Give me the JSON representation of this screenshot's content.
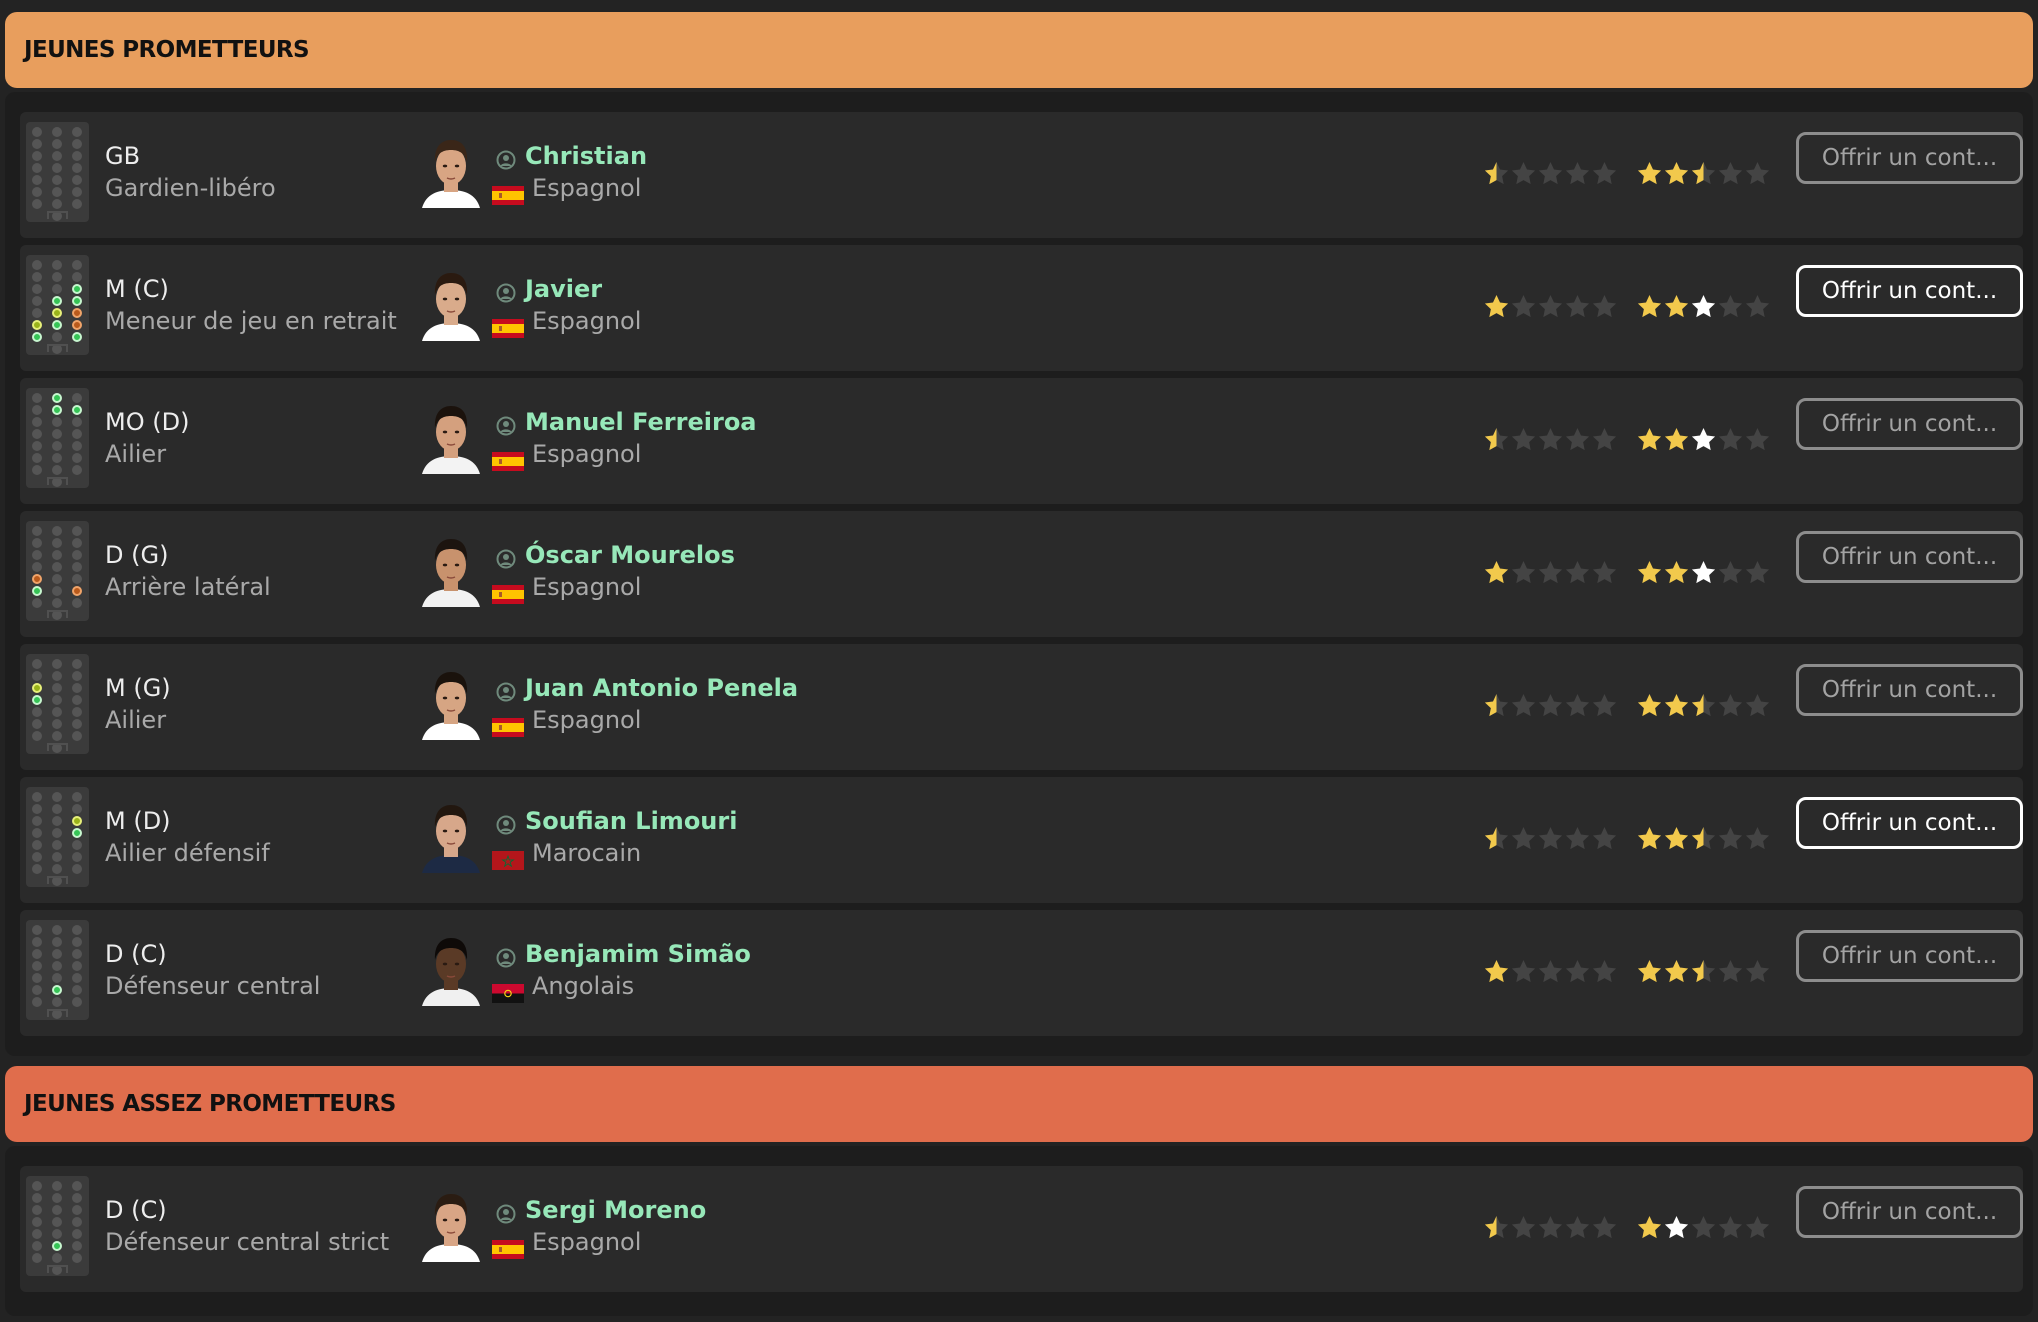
{
  "sections": [
    {
      "title": "JEUNES PROMETTEURS",
      "color": "#E89E5D",
      "players": [
        {
          "pos": "GB",
          "role": "Gardien-libéro",
          "name": "Christian",
          "nationality": "Espagnol",
          "flag": "spain",
          "current_stars": 0.5,
          "potential_stars": 2.5,
          "potential_certain": 2,
          "offer_label": "Offrir un cont...",
          "highlighted": false,
          "pitch": [
            [
              0,
              7,
              0
            ]
          ]
        },
        {
          "pos": "M (C)",
          "role": "Meneur de jeu en retrait",
          "name": "Javier",
          "nationality": "Espagnol",
          "flag": "spain",
          "current_stars": 1,
          "potential_stars": 3,
          "potential_certain": 2,
          "offer_label": "Offrir un cont...",
          "highlighted": true,
          "pitch": [
            [
              2,
              2,
              0
            ],
            [
              2,
              3,
              0
            ],
            [
              1,
              3,
              0
            ],
            [
              1,
              4,
              1
            ],
            [
              1,
              5,
              0
            ],
            [
              0,
              5,
              1
            ],
            [
              0,
              6,
              0
            ],
            [
              2,
              6,
              0
            ],
            [
              2,
              4,
              2
            ],
            [
              2,
              5,
              2
            ]
          ]
        },
        {
          "pos": "MO (D)",
          "role": "Ailier",
          "name": "Manuel Ferreiroa",
          "nationality": "Espagnol",
          "flag": "spain",
          "current_stars": 0.5,
          "potential_stars": 3,
          "potential_certain": 2,
          "offer_label": "Offrir un cont...",
          "highlighted": false,
          "pitch": [
            [
              1,
              1,
              0
            ],
            [
              2,
              1,
              0
            ],
            [
              1,
              0,
              0
            ]
          ]
        },
        {
          "pos": "D (G)",
          "role": "Arrière latéral",
          "name": "Óscar Mourelos",
          "nationality": "Espagnol",
          "flag": "spain",
          "current_stars": 1,
          "potential_stars": 3,
          "potential_certain": 2,
          "offer_label": "Offrir un cont...",
          "highlighted": false,
          "pitch": [
            [
              0,
              5,
              0
            ],
            [
              0,
              4,
              2
            ],
            [
              2,
              5,
              2
            ]
          ]
        },
        {
          "pos": "M (G)",
          "role": "Ailier",
          "name": "Juan Antonio Penela",
          "nationality": "Espagnol",
          "flag": "spain",
          "current_stars": 0.5,
          "potential_stars": 2.5,
          "potential_certain": 2,
          "offer_label": "Offrir un cont...",
          "highlighted": false,
          "pitch": [
            [
              0,
              2,
              1
            ],
            [
              0,
              3,
              0
            ]
          ]
        },
        {
          "pos": "M (D)",
          "role": "Ailier défensif",
          "name": "Soufian Limouri",
          "nationality": "Marocain",
          "flag": "morocco",
          "current_stars": 0.5,
          "potential_stars": 2.5,
          "potential_certain": 2,
          "offer_label": "Offrir un cont...",
          "highlighted": true,
          "pitch": [
            [
              2,
              2,
              1
            ],
            [
              2,
              3,
              0
            ]
          ]
        },
        {
          "pos": "D (C)",
          "role": "Défenseur central",
          "name": "Benjamim Simão",
          "nationality": "Angolais",
          "flag": "angola",
          "current_stars": 1,
          "potential_stars": 2.5,
          "potential_certain": 2,
          "offer_label": "Offrir un cont...",
          "highlighted": false,
          "pitch": [
            [
              1,
              5,
              0
            ]
          ]
        }
      ]
    },
    {
      "title": "JEUNES ASSEZ PROMETTEURS",
      "color": "#E06D4C",
      "players": [
        {
          "pos": "D (C)",
          "role": "Défenseur central strict",
          "name": "Sergi Moreno",
          "nationality": "Espagnol",
          "flag": "spain",
          "current_stars": 0.5,
          "potential_stars": 2,
          "potential_certain": 1,
          "offer_label": "Offrir un cont...",
          "highlighted": false,
          "pitch": [
            [
              1,
              5,
              0
            ]
          ]
        }
      ]
    }
  ],
  "colors": {
    "star_gold": "#F2C94C",
    "star_white": "#FFFFFF",
    "star_empty": "#444444",
    "player_name": "#97E8B9"
  }
}
